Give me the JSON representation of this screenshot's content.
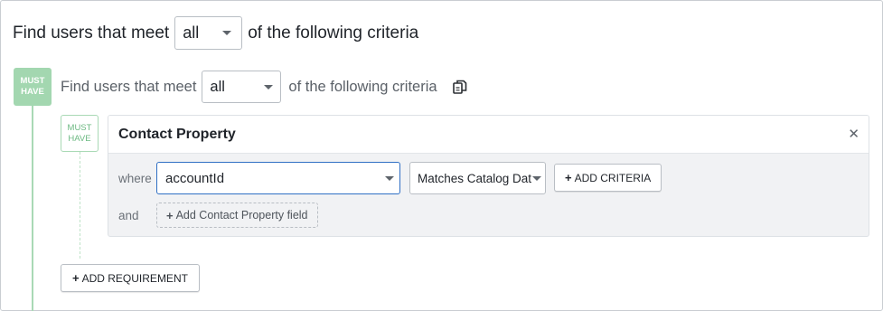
{
  "top": {
    "prefix": "Find users that meet",
    "match_value": "all",
    "suffix": "of the following criteria"
  },
  "group": {
    "badge_line1": "MUST",
    "badge_line2": "HAVE",
    "prefix": "Find users that meet",
    "match_value": "all",
    "suffix": "of the following criteria",
    "copy_icon": "copy-icon"
  },
  "condition": {
    "badge_line1": "MUST",
    "badge_line2": "HAVE",
    "title": "Contact Property",
    "close_icon": "close-icon",
    "where_label": "where",
    "and_label": "and",
    "field_value": "accountId",
    "operator_value": "Matches Catalog Data",
    "add_criteria_label": "ADD CRITERIA",
    "add_field_label": "Add Contact Property field"
  },
  "footer": {
    "add_requirement_label": "ADD REQUIREMENT"
  },
  "colors": {
    "must_have_green": "#a3d7b0",
    "focus_blue": "#2f6fc4"
  }
}
